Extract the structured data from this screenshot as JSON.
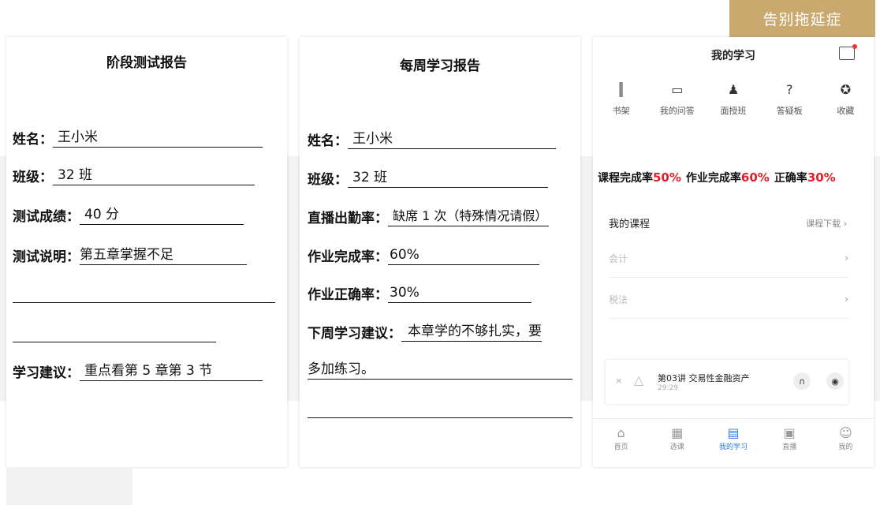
{
  "tag": "告别拖延症",
  "test_report": {
    "title": "阶段测试报告",
    "rows": [
      {
        "label": "姓名：",
        "value": "王小米"
      },
      {
        "label": "班级：",
        "value": "32 班"
      },
      {
        "label": "测试成绩：",
        "value": "40 分"
      },
      {
        "label": "测试说明：",
        "value": "第五章掌握不足"
      },
      {
        "label": "学习建议：",
        "value": "重点看第 5 章第 3 节"
      }
    ]
  },
  "weekly_report": {
    "title": "每周学习报告",
    "rows": [
      {
        "label": "姓名：",
        "value": "王小米"
      },
      {
        "label": "班级：",
        "value": "32 班"
      },
      {
        "label": "直播出勤率：",
        "value": "缺席 1 次（特殊情况请假）"
      },
      {
        "label": "作业完成率：",
        "value": "60%"
      },
      {
        "label": "作业正确率：",
        "value": "30%"
      },
      {
        "label": "下周学习建议：",
        "value": "本章学的不够扎实，要"
      }
    ],
    "continuation": "多加练习。"
  },
  "app": {
    "title": "我的学习",
    "icons": [
      {
        "label": "书架",
        "icon": "bookshelf-icon"
      },
      {
        "label": "我的问答",
        "icon": "chat-icon"
      },
      {
        "label": "面授班",
        "icon": "person-icon"
      },
      {
        "label": "答疑板",
        "icon": "question-board-icon"
      },
      {
        "label": "收藏",
        "icon": "star-icon"
      }
    ],
    "stats": [
      {
        "label": "课程完成率",
        "value": "50%"
      },
      {
        "label": "作业完成率",
        "value": "60%"
      },
      {
        "label": "正确率",
        "value": "30%"
      }
    ],
    "courses_heading": "我的课程",
    "courses_download": "课程下载 ›",
    "courses": [
      {
        "name": "会计"
      },
      {
        "name": "税法"
      }
    ],
    "player": {
      "episode": "第03讲  交易性金融资产",
      "time": "29:29"
    },
    "tabs": [
      {
        "label": "首页"
      },
      {
        "label": "选课"
      },
      {
        "label": "我的学习"
      },
      {
        "label": "直播"
      },
      {
        "label": "我的"
      }
    ],
    "accent": "#2d7be0",
    "stat_color": "#e0202a"
  }
}
